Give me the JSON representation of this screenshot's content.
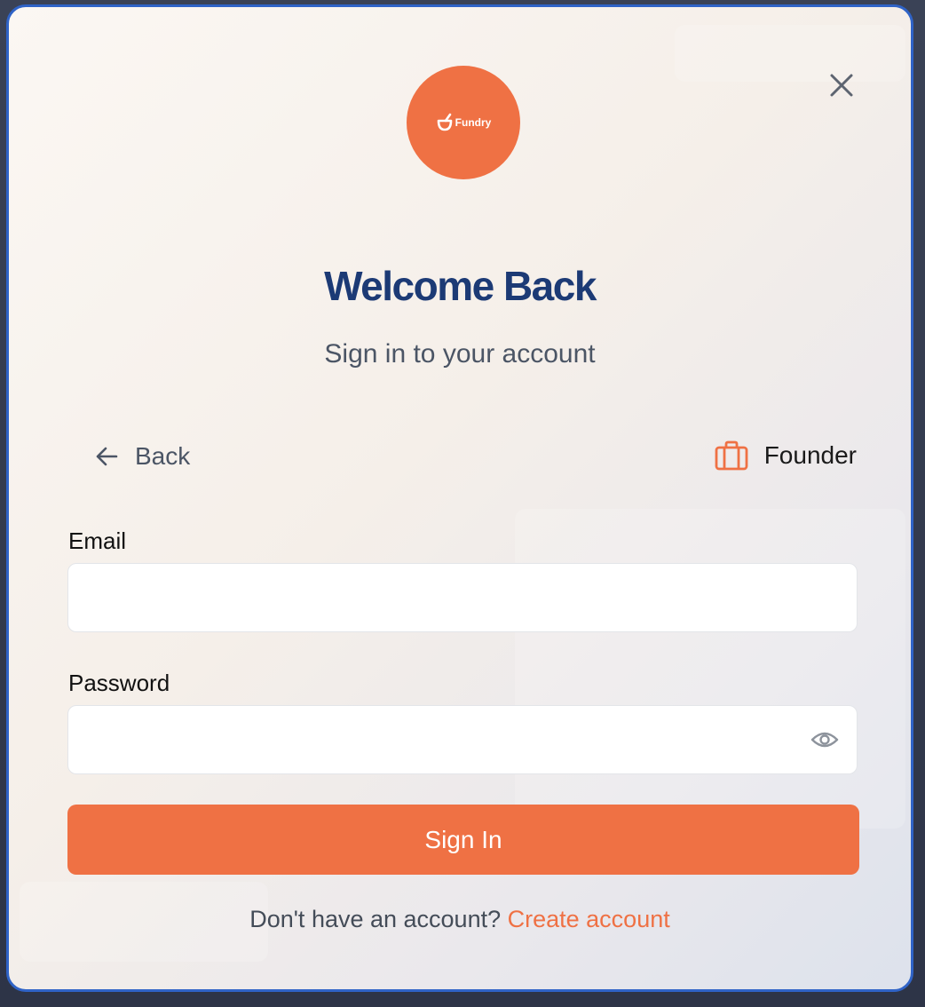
{
  "modal": {
    "logo_text": "Fundry",
    "title": "Welcome Back",
    "subtitle": "Sign in to your account"
  },
  "navigation": {
    "back_label": "Back",
    "back_icon": "arrow-left-icon",
    "close_icon": "close-icon"
  },
  "role": {
    "label": "Founder",
    "icon": "briefcase-icon"
  },
  "form": {
    "email_label": "Email",
    "email_value": "",
    "password_label": "Password",
    "password_value": "",
    "password_toggle_icon": "eye-icon",
    "submit_label": "Sign In"
  },
  "footer": {
    "prompt": "Don't have an account?",
    "link_label": "Create account"
  },
  "colors": {
    "accent": "#ef7144",
    "title": "#1c3a75",
    "border_focus": "#2f63c7"
  }
}
